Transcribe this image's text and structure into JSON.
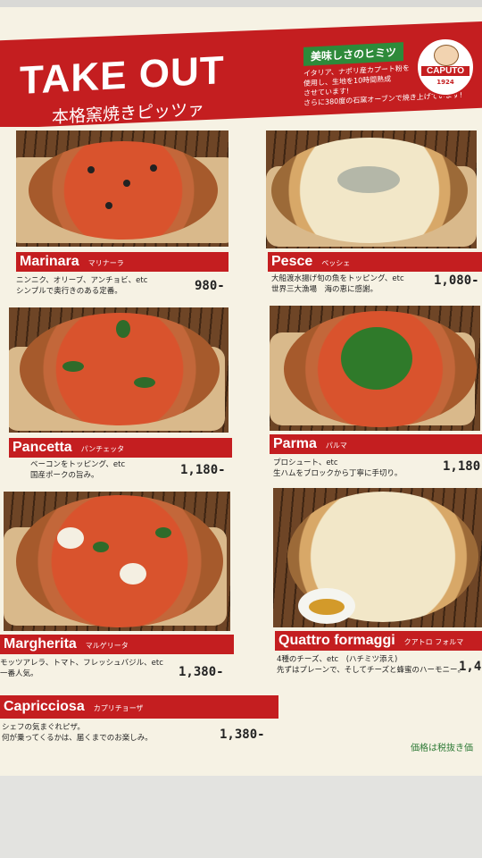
{
  "header": {
    "title": "TAKE OUT",
    "subtitle": "本格窯焼きピッツァ",
    "secret_tag": "美味しさのヒミツ",
    "secret_lines": [
      "イタリア、ナポリ産カプート粉を",
      "使用し、生地を10時間熟成",
      "させています!",
      "さらに380度の石窯オーブンで焼き上げています!"
    ],
    "logo_word": "CAPUTO",
    "logo_year": "1924"
  },
  "menu": [
    {
      "name": "Marinara",
      "jp": "マリナーラ",
      "desc": [
        "ニンニク、オリーブ、アンチョビ、etc",
        "シンプルで奥行きのある定番。"
      ],
      "price": "980-"
    },
    {
      "name": "Pesce",
      "jp": "ペッシェ",
      "desc": [
        "大船渡水揚げ旬の魚をトッピング、etc",
        "世界三大漁場　海の恵に感謝。"
      ],
      "price": "1,080-"
    },
    {
      "name": "Pancetta",
      "jp": "パンチェッタ",
      "desc": [
        "ベーコンをトッピング、etc",
        "国産ポークの旨み。"
      ],
      "price": "1,180-"
    },
    {
      "name": "Parma",
      "jp": "パルマ",
      "desc": [
        "プロシュート、etc",
        "生ハムをブロックから丁寧に手切り。"
      ],
      "price": "1,180"
    },
    {
      "name": "Margherita",
      "jp": "マルゲリータ",
      "desc": [
        "モッツアレラ、トマト、フレッシュバジル、etc",
        "一番人気。"
      ],
      "price": "1,380-"
    },
    {
      "name": "Quattro formaggi",
      "jp": "クアトロ フォルマ",
      "desc": [
        "4種のチーズ、etc　(ハチミツ添え)",
        "先ずはプレーンで、そしてチーズと蜂蜜のハーモニー。"
      ],
      "price": "1,4"
    },
    {
      "name": "Capricciosa",
      "jp": "カプリチョーザ",
      "desc": [
        "シェフの気まぐれピザ。",
        "何が乗ってくるかは、届くまでのお楽しみ。"
      ],
      "price": "1,380-"
    }
  ],
  "footnote": "価格は税抜き価"
}
